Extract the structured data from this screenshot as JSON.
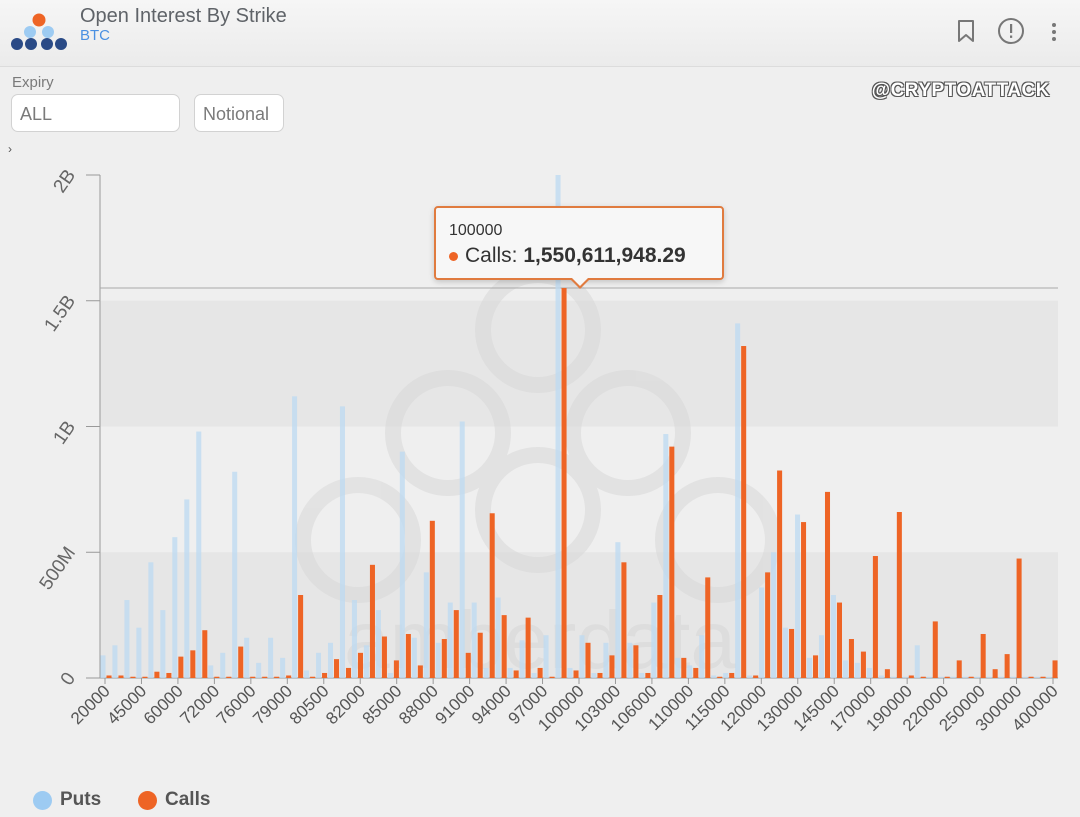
{
  "header": {
    "title": "Open Interest By Strike",
    "subtitle": "BTC",
    "icons": [
      "bookmark-icon",
      "info-icon",
      "more-vertical-icon"
    ]
  },
  "controls": {
    "expiry_label": "Expiry",
    "expiry_value": "ALL",
    "mode_value": "Notional"
  },
  "watermark_handle": "@CRYPTOATTACK",
  "watermark_brand": "amberdata",
  "colors": {
    "puts": "#bcdaf2",
    "calls": "#ee6425",
    "accent": "#4a90e2"
  },
  "tooltip": {
    "strike": "100000",
    "series_label": "Calls:",
    "value": "1,550,611,948.29"
  },
  "legend": [
    {
      "name": "Puts",
      "color": "#9dcbf2"
    },
    {
      "name": "Calls",
      "color": "#ee6425"
    }
  ],
  "chart_data": {
    "type": "bar",
    "ylim": [
      0,
      2000000000
    ],
    "y_ticks": [
      {
        "value": 0,
        "label": "0"
      },
      {
        "value": 500000000,
        "label": "500M"
      },
      {
        "value": 1000000000,
        "label": "1B"
      },
      {
        "value": 1500000000,
        "label": "1.5B"
      },
      {
        "value": 2000000000,
        "label": "2B"
      }
    ],
    "x_tick_labels": [
      "20000",
      "45000",
      "60000",
      "72000",
      "76000",
      "79000",
      "80500",
      "82000",
      "85000",
      "88000",
      "91000",
      "94000",
      "97000",
      "100000",
      "103000",
      "106000",
      "110000",
      "115000",
      "120000",
      "130000",
      "145000",
      "170000",
      "190000",
      "220000",
      "250000",
      "300000",
      "400000"
    ],
    "highlight_index": 38,
    "highlight_line_value": 1550611948.29,
    "grid": true,
    "legend_position": "bottom-left",
    "series": [
      {
        "name": "Puts",
        "values": [
          90000000,
          130000000,
          310000000,
          200000000,
          460000000,
          270000000,
          560000000,
          710000000,
          980000000,
          50000000,
          100000000,
          820000000,
          160000000,
          60000000,
          160000000,
          80000000,
          1120000000,
          30000000,
          100000000,
          140000000,
          1080000000,
          310000000,
          130000000,
          270000000,
          20000000,
          900000000,
          160000000,
          420000000,
          140000000,
          300000000,
          1020000000,
          300000000,
          40000000,
          320000000,
          40000000,
          150000000,
          20000000,
          170000000,
          2000000000,
          40000000,
          170000000,
          20000000,
          140000000,
          540000000,
          140000000,
          20000000,
          300000000,
          970000000,
          80000000,
          50000000,
          170000000,
          10000000,
          20000000,
          1410000000,
          10000000,
          360000000,
          500000000,
          200000000,
          650000000,
          80000000,
          170000000,
          330000000,
          70000000,
          60000000,
          40000000,
          10000000,
          5000000,
          5000000,
          130000000,
          5000000,
          5000000,
          5000000,
          5000000,
          5000000,
          5000000,
          5000000,
          5000000,
          5000000,
          5000000,
          5000000
        ]
      },
      {
        "name": "Calls",
        "values": [
          10000000,
          10000000,
          5000000,
          5000000,
          25000000,
          20000000,
          85000000,
          110000000,
          190000000,
          5000000,
          5000000,
          125000000,
          5000000,
          5000000,
          5000000,
          10000000,
          330000000,
          5000000,
          20000000,
          75000000,
          40000000,
          100000000,
          450000000,
          165000000,
          70000000,
          175000000,
          50000000,
          625000000,
          155000000,
          270000000,
          100000000,
          180000000,
          655000000,
          250000000,
          30000000,
          240000000,
          40000000,
          5000000,
          1550611948.29,
          30000000,
          140000000,
          20000000,
          90000000,
          460000000,
          130000000,
          20000000,
          330000000,
          920000000,
          80000000,
          40000000,
          400000000,
          5000000,
          20000000,
          1320000000,
          10000000,
          420000000,
          825000000,
          195000000,
          620000000,
          90000000,
          740000000,
          300000000,
          155000000,
          105000000,
          485000000,
          35000000,
          660000000,
          10000000,
          5000000,
          225000000,
          5000000,
          70000000,
          5000000,
          175000000,
          35000000,
          95000000,
          475000000,
          5000000,
          5000000,
          70000000
        ]
      }
    ]
  }
}
